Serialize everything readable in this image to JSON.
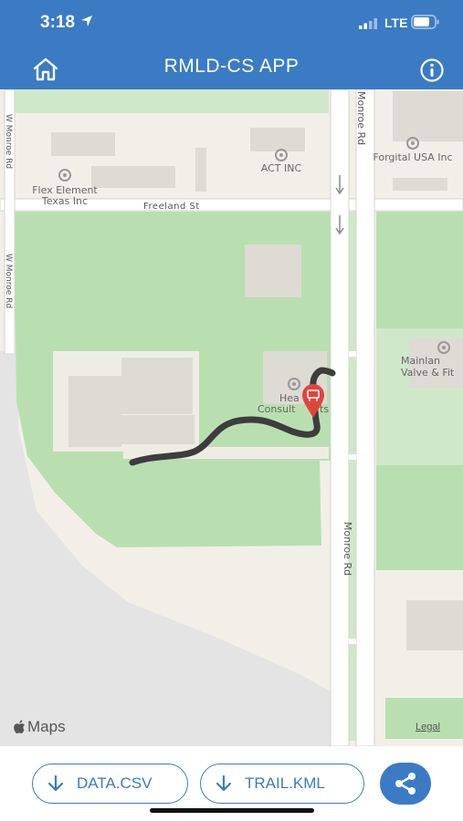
{
  "status_bar": {
    "time": "3:18",
    "carrier": "LTE"
  },
  "header": {
    "title": "RMLD-CS APP",
    "home_icon": "home-icon",
    "info_icon": "info-icon"
  },
  "map": {
    "streets": {
      "freeland": "Freeland St",
      "monroe_top": "Monroe Rd",
      "monroe_mid": "Monroe Rd",
      "w_monroe_top": "W Monroe Rd",
      "w_monroe_mid": "W Monroe Rd"
    },
    "places": {
      "flex_line1": "Flex Element",
      "flex_line2": "Texas Inc",
      "act": "ACT INC",
      "forgital": "Forgital USA Inc",
      "mainland_line1": "Mainlan",
      "mainland_line2": "Valve & Fit",
      "heat_line1": "Hea",
      "heat_line2": "Consult",
      "heat_line2b": "ts"
    },
    "attribution": "Maps",
    "legal": "Legal",
    "trail_color": "#3d3d3d",
    "pin_color": "#e0453a"
  },
  "bottom_bar": {
    "csv_label": "DATA.CSV",
    "kml_label": "TRAIL.KML",
    "download_icon": "download-arrow-icon",
    "share_icon": "share-icon"
  },
  "colors": {
    "accent": "#3a7bc4",
    "park": "#b7deb0",
    "water": "#e4e4e4",
    "land": "#f2efe9"
  }
}
